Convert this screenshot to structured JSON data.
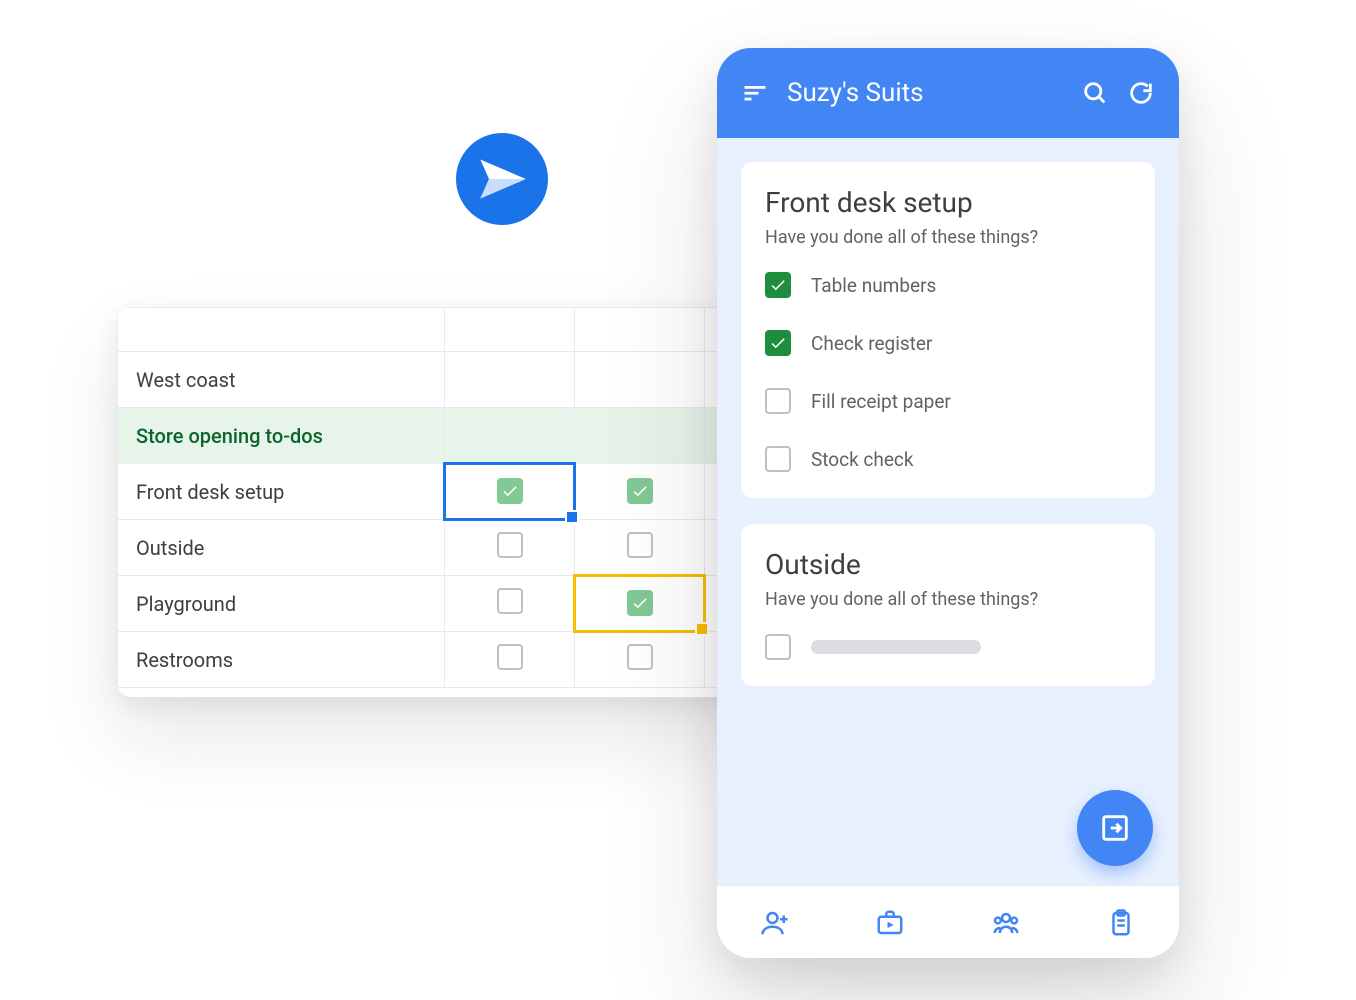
{
  "colors": {
    "primary": "#4285f4",
    "primary_dark": "#1a73e8",
    "green_cell": "#81c995",
    "green_check": "#1e8e3e",
    "section_bg": "#e6f4ea",
    "section_fg": "#0d652d",
    "selection_yellow": "#fbbc04"
  },
  "plane_icon": "paper-plane-icon",
  "sheet": {
    "rows": [
      {
        "label": "West coast",
        "type": "plain"
      },
      {
        "label": "Store opening to-dos",
        "type": "section"
      },
      {
        "label": "Front desk setup",
        "type": "data",
        "colB": "checked",
        "colC": "checked",
        "selB": "blue"
      },
      {
        "label": "Outside",
        "type": "data",
        "colB": "empty",
        "colC": "empty"
      },
      {
        "label": "Playground",
        "type": "data",
        "colB": "empty",
        "colC": "checked",
        "selC": "yellow"
      },
      {
        "label": "Restrooms",
        "type": "data",
        "colB": "empty",
        "colC": "empty"
      }
    ]
  },
  "phone": {
    "appbar": {
      "title": "Suzy's Suits",
      "sort_icon": "sort-icon",
      "search_icon": "search-icon",
      "refresh_icon": "refresh-icon"
    },
    "cards": [
      {
        "title": "Front desk setup",
        "subtitle": "Have you done all of these things?",
        "items": [
          {
            "label": "Table numbers",
            "done": true
          },
          {
            "label": "Check register",
            "done": true
          },
          {
            "label": "Fill receipt paper",
            "done": false
          },
          {
            "label": "Stock check",
            "done": false
          }
        ]
      },
      {
        "title": "Outside",
        "subtitle": "Have you done all of these things?",
        "items": [
          {
            "label": "",
            "done": false,
            "skeleton": true
          }
        ]
      }
    ],
    "fab_icon": "submit-icon",
    "nav": [
      {
        "icon": "person-add-icon"
      },
      {
        "icon": "briefcase-play-icon"
      },
      {
        "icon": "group-icon"
      },
      {
        "icon": "clipboard-icon"
      }
    ]
  }
}
